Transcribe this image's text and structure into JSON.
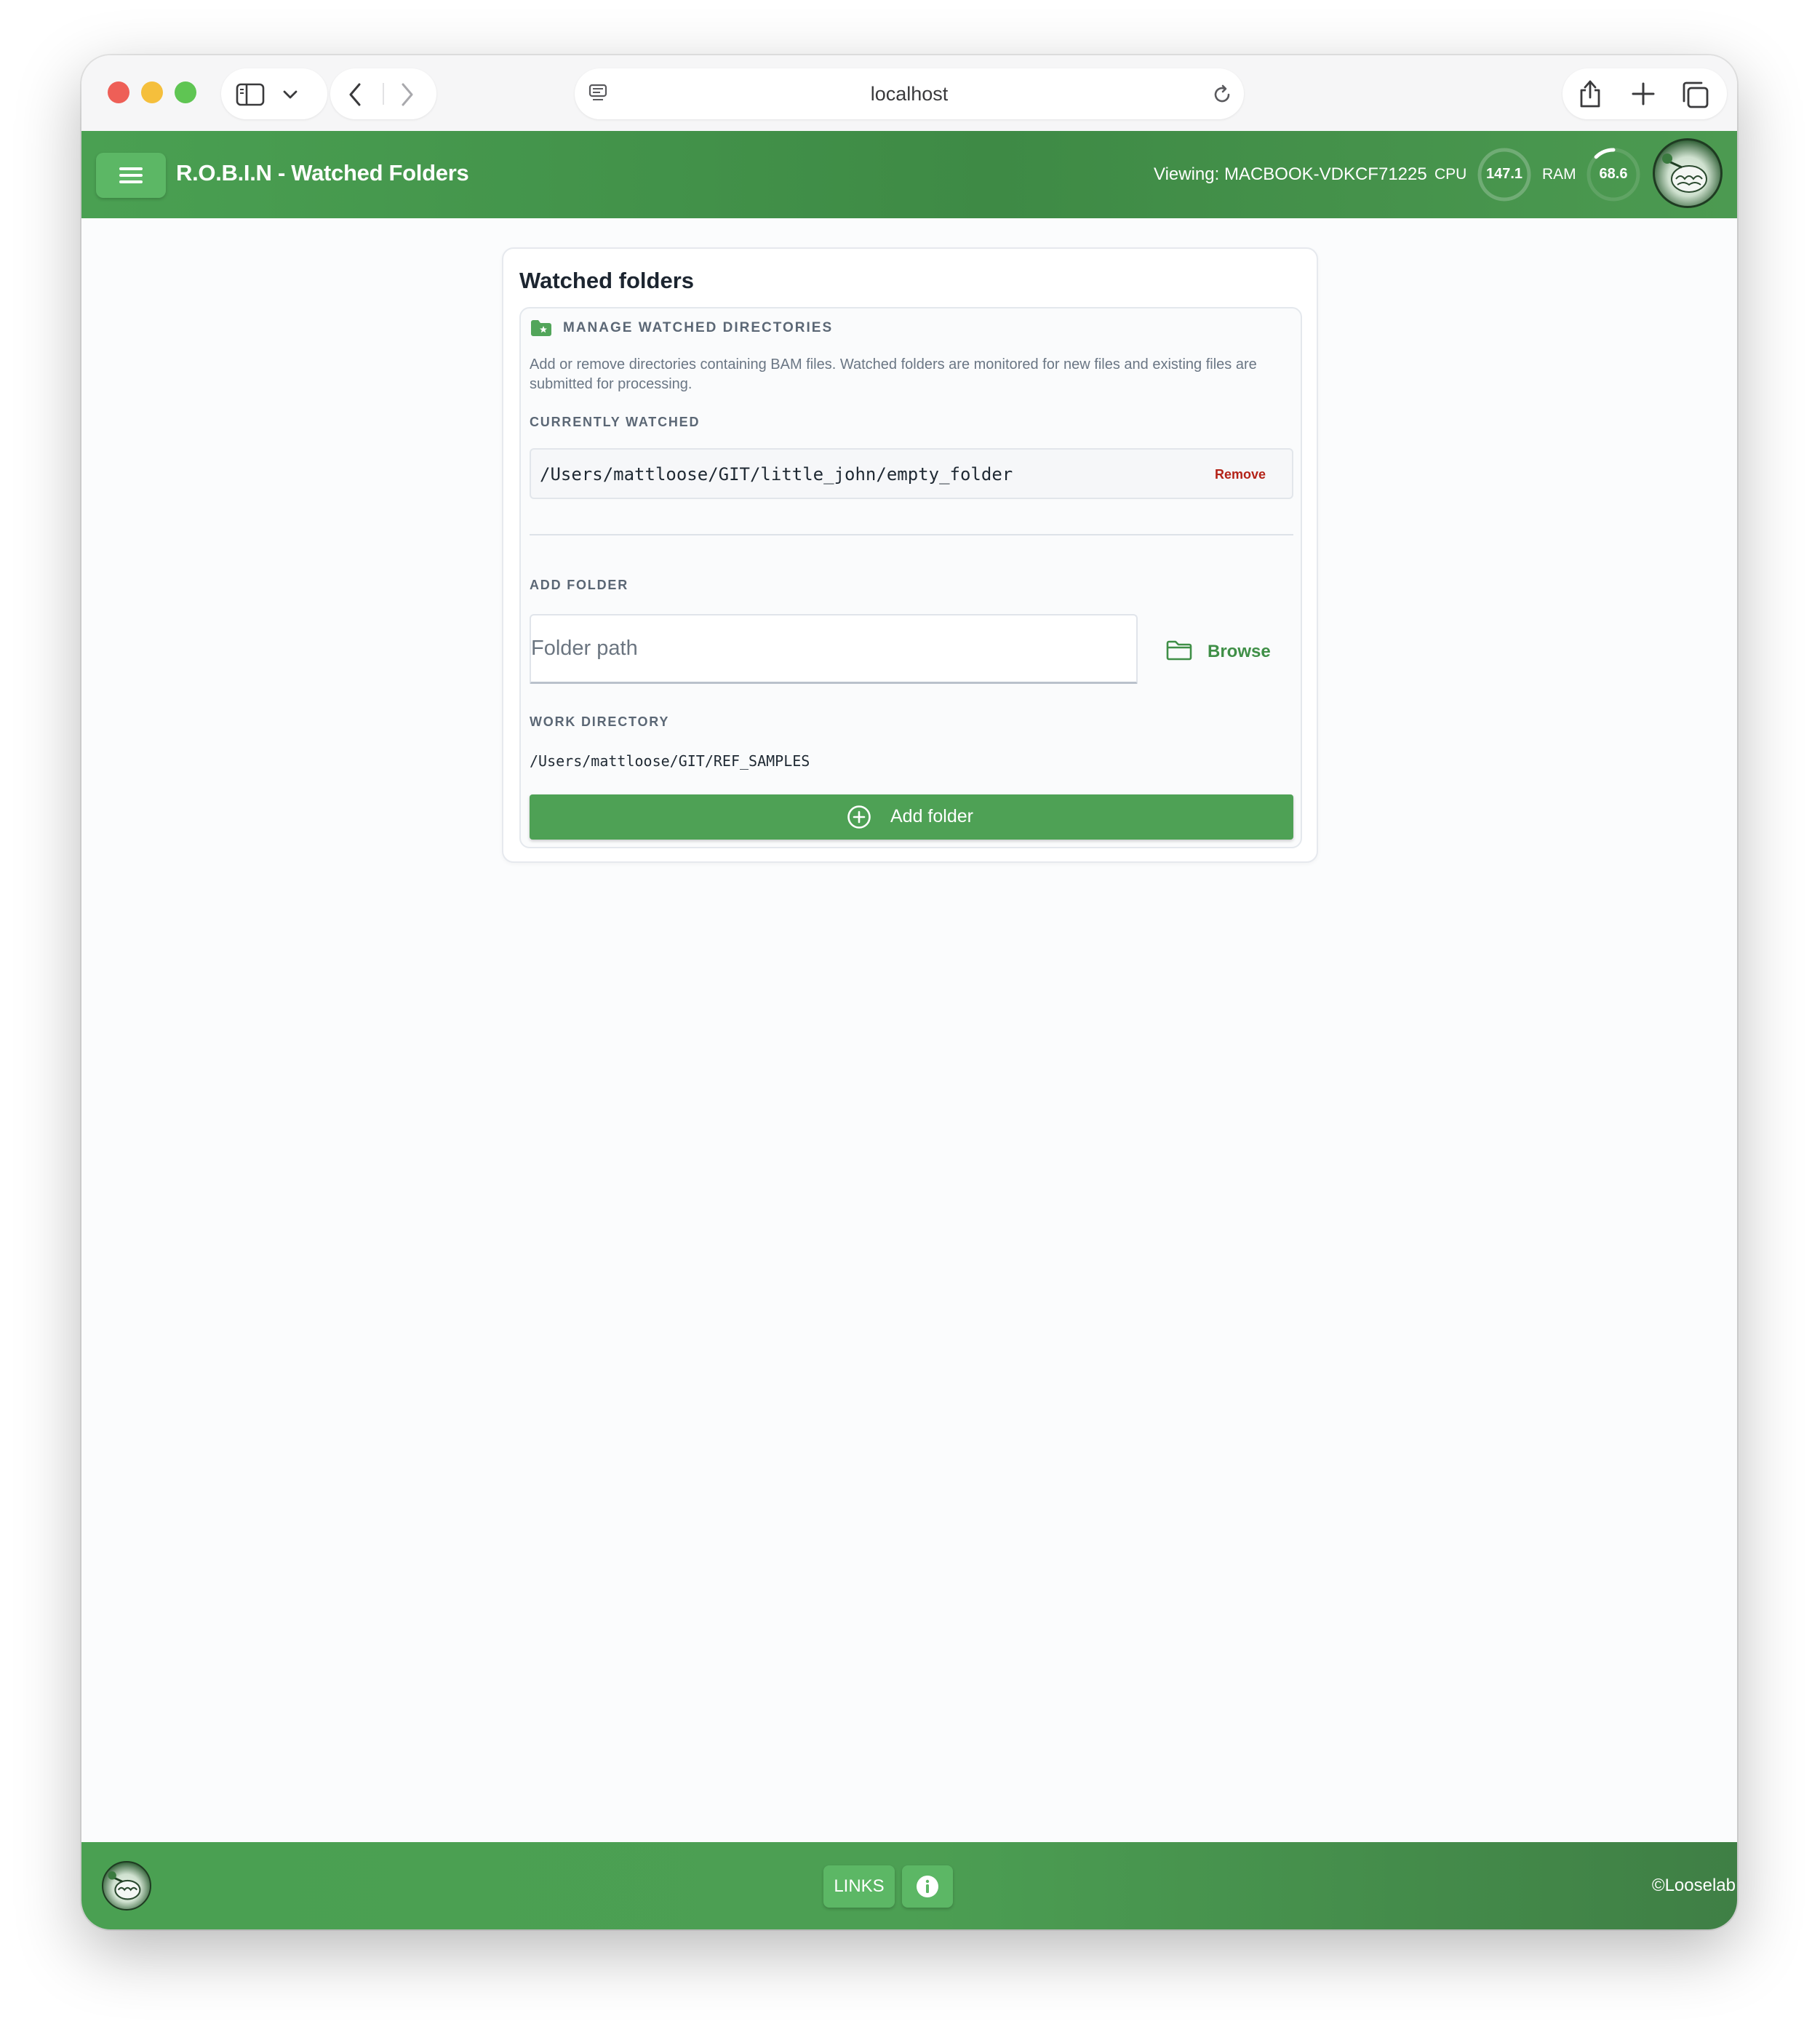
{
  "browser": {
    "url": "localhost",
    "icons": [
      "sidebar-icon",
      "chevron-down-icon",
      "back-icon",
      "forward-icon",
      "reader-icon",
      "reload-icon",
      "share-icon",
      "new-tab-icon",
      "tabs-overview-icon"
    ]
  },
  "header": {
    "title": "R.O.B.I.N - Watched Folders",
    "viewing": "Viewing: MACBOOK-VDKCF71225",
    "cpu_label": "CPU",
    "cpu_value": "147.1",
    "cpu_percent": 100,
    "ram_label": "RAM",
    "ram_value": "68.6",
    "ram_percent": 68.6
  },
  "card": {
    "title": "Watched folders",
    "panel": {
      "heading": "MANAGE WATCHED DIRECTORIES",
      "description": "Add or remove directories containing BAM files. Watched folders are monitored for new files and existing files are submitted for processing.",
      "currently_watched_label": "CURRENTLY WATCHED",
      "watched": [
        {
          "path": "/Users/mattloose/GIT/little_john/empty_folder",
          "remove_label": "Remove"
        }
      ],
      "add_folder_label": "ADD FOLDER",
      "folder_input": {
        "placeholder": "Folder path",
        "value": ""
      },
      "browse_label": "Browse",
      "work_directory_label": "WORK DIRECTORY",
      "work_directory": "/Users/mattloose/GIT/REF_SAMPLES",
      "add_button_label": "Add folder"
    }
  },
  "footer": {
    "links_label": "LINKS",
    "copyright": "©Looselab"
  },
  "colors": {
    "brand_green": "#4aa052",
    "button_green": "#5cb765",
    "add_button": "#4ea155",
    "remove_red": "#b42318",
    "browse_green": "#3f8f47"
  }
}
